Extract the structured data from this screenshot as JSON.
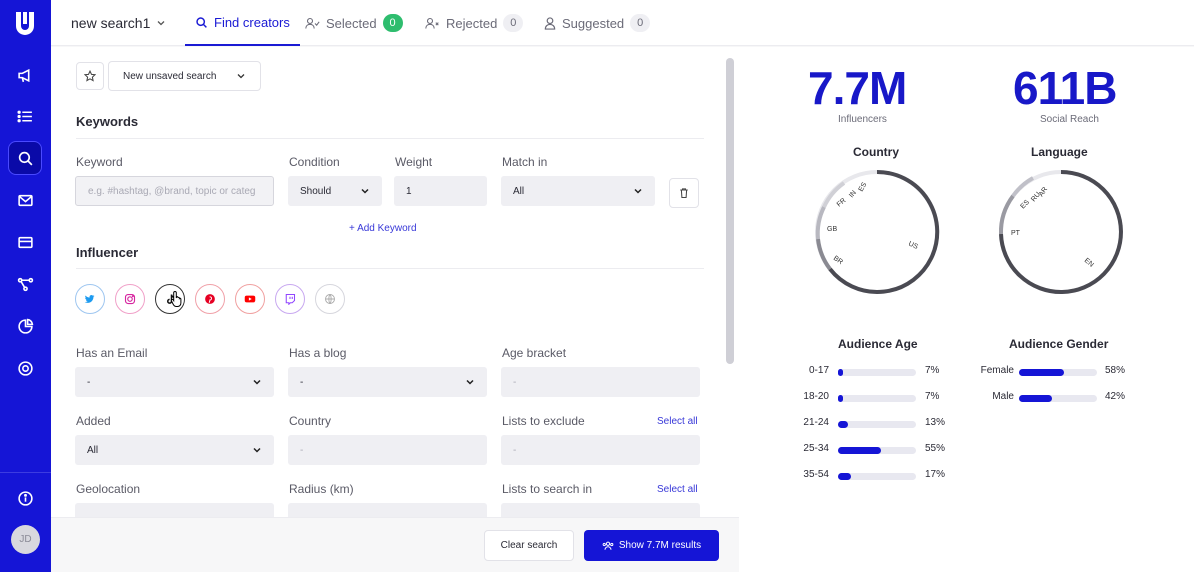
{
  "colors": {
    "brand": "#1515d6",
    "accent": "#1a1ad4",
    "green": "#2ebd6e"
  },
  "sidebar": {
    "avatar_initials": "JD",
    "icons": [
      "megaphone-icon",
      "list-icon",
      "search-icon",
      "mail-icon",
      "card-icon",
      "flow-icon",
      "chart-icon",
      "support-icon",
      "info-icon"
    ]
  },
  "topbar": {
    "search_name": "new search1",
    "tabs": [
      {
        "label": "Find creators",
        "active": true
      },
      {
        "label": "Selected",
        "count": "0"
      },
      {
        "label": "Rejected",
        "count": "0"
      },
      {
        "label": "Suggested",
        "count": "0"
      }
    ]
  },
  "search": {
    "saved_select": "New unsaved search"
  },
  "keywords": {
    "title": "Keywords",
    "keyword_label": "Keyword",
    "keyword_placeholder": "e.g. #hashtag, @brand, topic or categ",
    "condition_label": "Condition",
    "condition_value": "Should",
    "weight_label": "Weight",
    "weight_value": "1",
    "match_label": "Match in",
    "match_value": "All",
    "add_keyword": "+ Add Keyword"
  },
  "influencer": {
    "title": "Influencer",
    "platforms": [
      "twitter",
      "instagram",
      "tiktok",
      "pinterest",
      "youtube",
      "twitch",
      "other"
    ],
    "has_email_label": "Has an Email",
    "has_email_value": "-",
    "has_blog_label": "Has a blog",
    "has_blog_value": "-",
    "age_bracket_label": "Age bracket",
    "age_bracket_value": "-",
    "added_label": "Added",
    "added_value": "All",
    "country_label": "Country",
    "country_value": "-",
    "lists_exclude_label": "Lists to exclude",
    "lists_exclude_value": "-",
    "select_all": "Select all",
    "geolocation_label": "Geolocation",
    "radius_label": "Radius (km)",
    "lists_search_label": "Lists to search in"
  },
  "actions": {
    "clear": "Clear search",
    "show": "Show 7.7M results"
  },
  "stats": {
    "influencers_value": "7.7M",
    "influencers_label": "Influencers",
    "reach_value": "611B",
    "reach_label": "Social Reach",
    "country_title": "Country",
    "country_labels": [
      "ES",
      "IN",
      "FR",
      "GB",
      "BR",
      "US"
    ],
    "language_title": "Language",
    "language_labels": [
      "AR",
      "RU",
      "ES",
      "PT",
      "EN"
    ],
    "age_title": "Audience Age",
    "age": [
      {
        "label": "0-17",
        "value": "7%",
        "pct": 7
      },
      {
        "label": "18-20",
        "value": "7%",
        "pct": 7
      },
      {
        "label": "21-24",
        "value": "13%",
        "pct": 13
      },
      {
        "label": "25-34",
        "value": "55%",
        "pct": 55
      },
      {
        "label": "35-54",
        "value": "17%",
        "pct": 17
      }
    ],
    "gender_title": "Audience Gender",
    "gender": [
      {
        "label": "Female",
        "value": "58%",
        "pct": 58
      },
      {
        "label": "Male",
        "value": "42%",
        "pct": 42
      }
    ]
  }
}
